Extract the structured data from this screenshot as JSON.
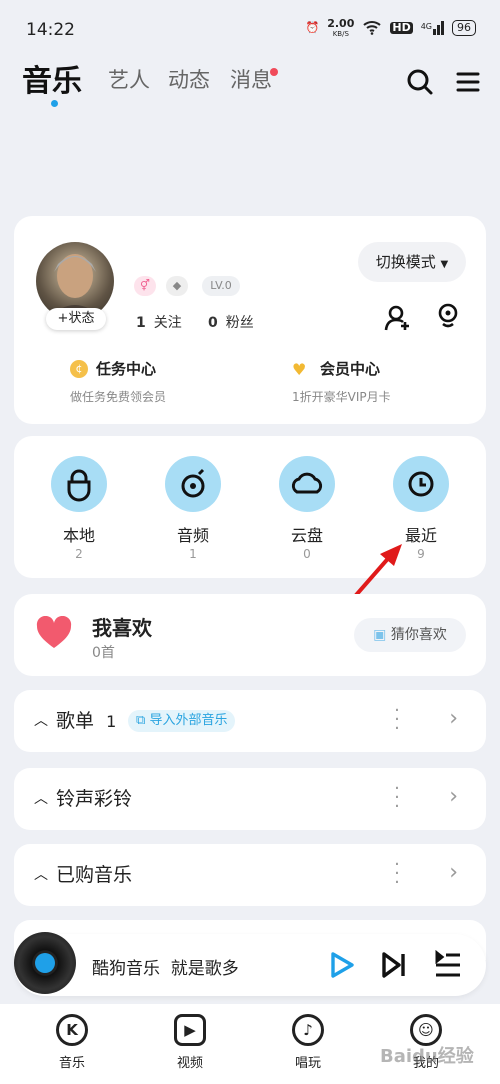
{
  "status_bar": {
    "time": "14:22",
    "net_speed": "2.00",
    "net_unit": "KB/S",
    "hd": "HD",
    "signal": "4G",
    "battery": "96"
  },
  "top_nav": {
    "tabs": [
      {
        "label": "音乐"
      },
      {
        "label": "艺人"
      },
      {
        "label": "动态"
      },
      {
        "label": "消息"
      }
    ]
  },
  "profile": {
    "status_button": "+状态",
    "level": "LV.0",
    "mode_button": "切换模式",
    "following_count": "1",
    "following_label": "关注",
    "followers_count": "0",
    "followers_label": "粉丝",
    "task_center": {
      "title": "任务中心",
      "subtitle": "做任务免费领会员"
    },
    "vip_center": {
      "title": "会员中心",
      "subtitle": "1折开豪华VIP月卡"
    }
  },
  "quick_access": [
    {
      "label": "本地",
      "count": "2",
      "icon": "local-icon"
    },
    {
      "label": "音频",
      "count": "1",
      "icon": "audio-icon"
    },
    {
      "label": "云盘",
      "count": "0",
      "icon": "cloud-icon"
    },
    {
      "label": "最近",
      "count": "9",
      "icon": "clock-icon"
    }
  ],
  "favorites": {
    "title": "我喜欢",
    "count": "0首",
    "guess_button": "猜你喜欢"
  },
  "sections": {
    "playlist": {
      "title": "歌单",
      "count": "1",
      "import_label": "导入外部音乐"
    },
    "ringtone": {
      "title": "铃声彩铃"
    },
    "purchased": {
      "title": "已购音乐"
    }
  },
  "player": {
    "text": "酷狗音乐  就是歌多"
  },
  "bottom_tabs": [
    {
      "label": "音乐",
      "icon": "K"
    },
    {
      "label": "视频",
      "icon": "▶"
    },
    {
      "label": "唱玩",
      "icon": "♪"
    },
    {
      "label": "我的",
      "icon": "☺"
    }
  ],
  "watermark": "Baidu经验",
  "colors": {
    "accent": "#1fa0e8",
    "red_dot": "#f04a5a",
    "circle_bg": "#a8ddf5",
    "heart": "#f25a6e",
    "arrow": "#e01a1a"
  }
}
